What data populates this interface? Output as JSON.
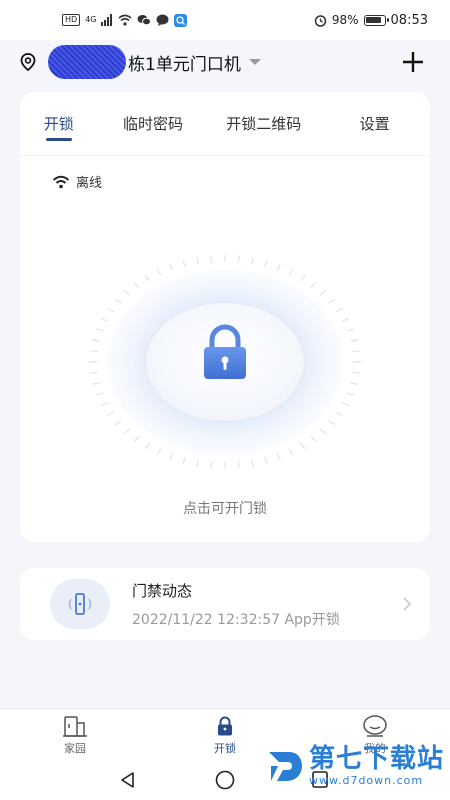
{
  "status_bar": {
    "hd": "HD",
    "network": "4G",
    "battery_pct": "98%",
    "time": "08:53"
  },
  "header": {
    "device_name": "栋1单元门口机"
  },
  "tabs": [
    {
      "label": "开锁",
      "active": true
    },
    {
      "label": "临时密码",
      "active": false
    },
    {
      "label": "开锁二维码",
      "active": false
    },
    {
      "label": "设置",
      "active": false
    }
  ],
  "unlock": {
    "connection_status": "离线",
    "hint": "点击可开门锁"
  },
  "activity": {
    "title": "门禁动态",
    "detail": "2022/11/22 12:32:57 App开锁"
  },
  "bottom_nav": [
    {
      "label": "家园",
      "icon": "home-building-icon",
      "active": false
    },
    {
      "label": "开锁",
      "icon": "lock-icon",
      "active": true
    },
    {
      "label": "我的",
      "icon": "profile-icon",
      "active": false
    }
  ],
  "watermark": {
    "name": "第七下载站",
    "url": "www.d7down.com"
  },
  "colors": {
    "accent": "#2a4a8a",
    "lock_blue": "#4a78d6",
    "watermark_blue": "#2a7fd4"
  }
}
